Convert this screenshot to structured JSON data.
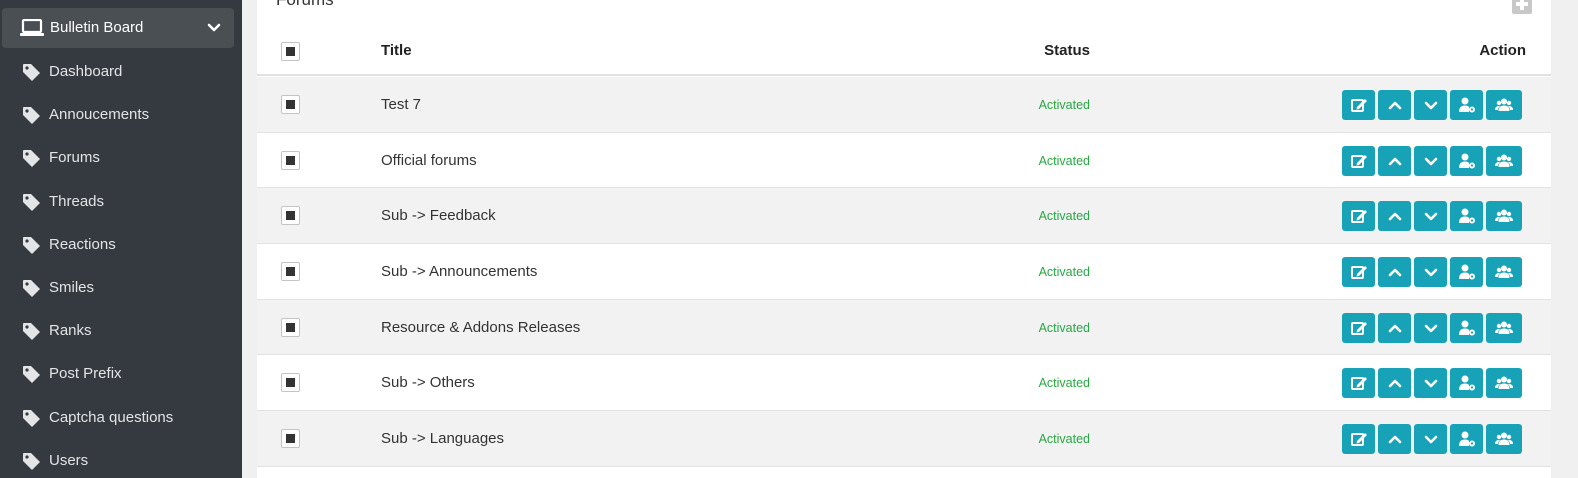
{
  "sidebar": {
    "header": {
      "label": "Bulletin Board",
      "icon": "laptop-icon"
    },
    "items": [
      {
        "label": "Dashboard",
        "icon": "tag-icon"
      },
      {
        "label": "Annoucements",
        "icon": "tag-icon"
      },
      {
        "label": "Forums",
        "icon": "tag-icon"
      },
      {
        "label": "Threads",
        "icon": "tag-icon"
      },
      {
        "label": "Reactions",
        "icon": "tag-icon"
      },
      {
        "label": "Smiles",
        "icon": "tag-icon"
      },
      {
        "label": "Ranks",
        "icon": "tag-icon"
      },
      {
        "label": "Post Prefix",
        "icon": "tag-icon"
      },
      {
        "label": "Captcha questions",
        "icon": "tag-icon"
      },
      {
        "label": "Users",
        "icon": "tag-icon"
      }
    ]
  },
  "panel": {
    "title": "Forums",
    "columns": {
      "title": "Title",
      "status": "Status",
      "action": "Action"
    },
    "rows": [
      {
        "title": "Test 7",
        "status": "Activated"
      },
      {
        "title": "Official forums",
        "status": "Activated"
      },
      {
        "title": "Sub -> Feedback",
        "status": "Activated"
      },
      {
        "title": "Sub -> Announcements",
        "status": "Activated"
      },
      {
        "title": "Resource & Addons Releases",
        "status": "Activated"
      },
      {
        "title": "Sub -> Others",
        "status": "Activated"
      },
      {
        "title": "Sub -> Languages",
        "status": "Activated"
      }
    ],
    "row_actions": [
      "edit-icon",
      "chevron-up-icon",
      "chevron-down-icon",
      "user-settings-icon",
      "users-icon"
    ]
  },
  "colors": {
    "sidebar_bg": "#343a40",
    "action_button": "#17a2b8",
    "status_active": "#28a745"
  }
}
